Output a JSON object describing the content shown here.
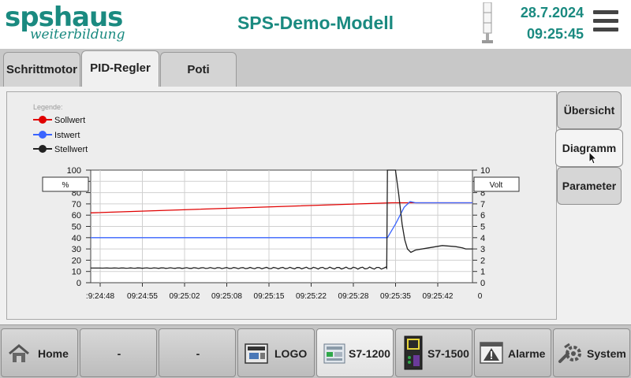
{
  "header": {
    "logo_main": "spshaus",
    "logo_sub": "weiterbildung",
    "title": "SPS-Demo-Modell",
    "date": "28.7.2024",
    "time": "09:25:45",
    "menu_icon": "hamburger-icon",
    "status_icon": "signal-tower-icon"
  },
  "tabs": [
    {
      "label": "Schrittmotor",
      "active": false
    },
    {
      "label": "PID-Regler",
      "active": true
    },
    {
      "label": "Poti",
      "active": false
    }
  ],
  "side_buttons": [
    {
      "label": "Übersicht",
      "active": false
    },
    {
      "label": "Diagramm",
      "active": true
    },
    {
      "label": "Parameter",
      "active": false
    }
  ],
  "chart": {
    "legend_title": "Legende:",
    "left_unit": "%",
    "right_unit": "Volt",
    "colors": {
      "sollwert": "#e00000",
      "istwert": "#3a64ff",
      "stellwert": "#222222"
    }
  },
  "chart_data": {
    "type": "line",
    "x_tick_labels": [
      ":9:24:48",
      "09:24:55",
      "09:25:02",
      "09:25:08",
      "09:25:15",
      "09:25:22",
      "09:25:28",
      "09:25:35",
      "09:25:42",
      "0"
    ],
    "y_left_ticks": [
      "100",
      "90",
      "80",
      "70",
      "60",
      "50",
      "40",
      "30",
      "20",
      "10",
      "0"
    ],
    "y_right_ticks": [
      "10",
      "9",
      "8",
      "7",
      "6",
      "5",
      "4",
      "3",
      "2",
      "1",
      "0"
    ],
    "ylim_left": [
      0,
      100
    ],
    "ylim_right": [
      0,
      10
    ],
    "xlim": [
      0,
      57
    ],
    "grid": true,
    "legend_position": "top-left",
    "series": [
      {
        "name": "Sollwert",
        "color": "#e00000",
        "x": [
          0,
          45,
          57
        ],
        "y": [
          62,
          71,
          71
        ]
      },
      {
        "name": "Istwert",
        "color": "#3a64ff",
        "x": [
          0,
          44.3,
          45.5,
          46.8,
          47.7,
          48.5,
          57
        ],
        "y": [
          40,
          40,
          52,
          67,
          72,
          71,
          71
        ]
      },
      {
        "name": "Stellwert",
        "color": "#222222",
        "x": [
          0,
          44.2,
          44.3,
          45.5,
          46.0,
          46.5,
          46.9,
          47.3,
          47.8,
          48.5,
          50.5,
          52.5,
          54.5,
          55.5,
          56,
          57
        ],
        "y": [
          13,
          13,
          100,
          100,
          78,
          52,
          38,
          30,
          27,
          29,
          31,
          33,
          32,
          31,
          30,
          30
        ]
      }
    ]
  },
  "nav": [
    {
      "label": "Home",
      "icon": "house-icon",
      "active": false
    },
    {
      "label": "-",
      "icon": "",
      "active": false
    },
    {
      "label": "-",
      "icon": "",
      "active": false
    },
    {
      "label": "LOGO",
      "icon": "logo-plc-icon",
      "active": false
    },
    {
      "label": "S7-1200",
      "icon": "s7-1200-plc-icon",
      "active": true
    },
    {
      "label": "S7-1500",
      "icon": "s7-1500-plc-icon",
      "active": false
    },
    {
      "label": "Alarme",
      "icon": "alarm-warning-icon",
      "active": false
    },
    {
      "label": "System",
      "icon": "system-gear-icon",
      "active": false
    }
  ]
}
